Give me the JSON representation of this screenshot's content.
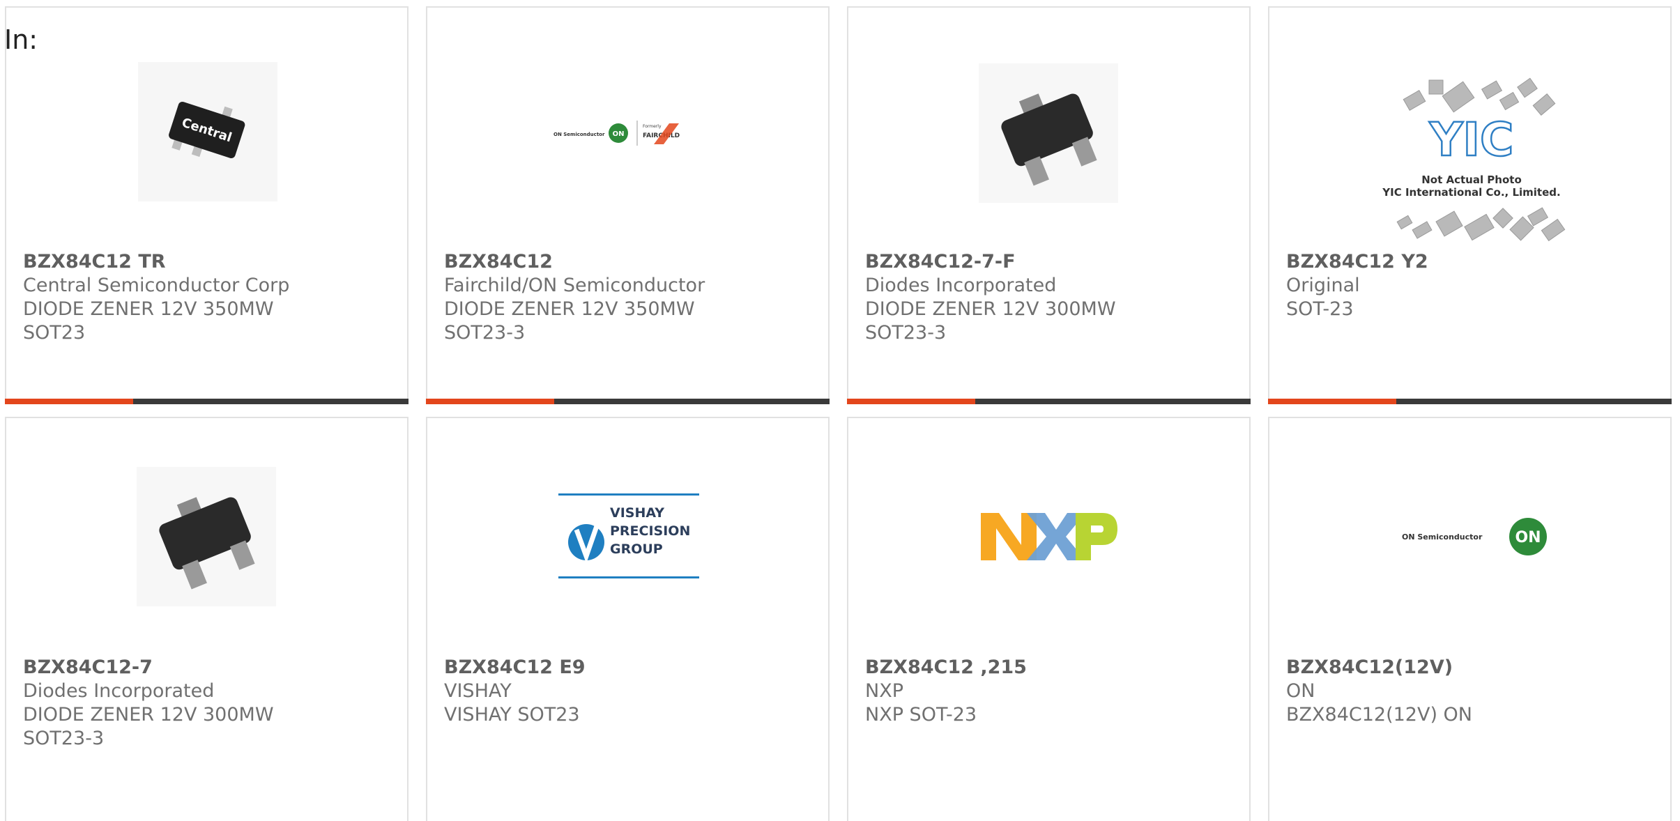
{
  "page": {
    "label": "In:"
  },
  "products": [
    {
      "part_number": "BZX84C12 TR",
      "manufacturer": "Central Semiconductor Corp",
      "description": "DIODE ZENER 12V 350MW",
      "package": "SOT23",
      "image": "central-sot23-icon",
      "brand_text": "Central"
    },
    {
      "part_number": "BZX84C12",
      "manufacturer": "Fairchild/ON Semiconductor",
      "description": "DIODE ZENER 12V 350MW",
      "package": "SOT23-3",
      "image": "on-fairchild-logo",
      "logo_on": "ON Semiconductor",
      "logo_formerly": "Formerly",
      "logo_fairchild": "FAIRCHILD"
    },
    {
      "part_number": "BZX84C12-7-F",
      "manufacturer": "Diodes Incorporated",
      "description": "DIODE ZENER 12V 300MW",
      "package": "SOT23-3",
      "image": "sot23-package-icon"
    },
    {
      "part_number": "BZX84C12 Y2",
      "manufacturer": "Original",
      "description": "SOT-23",
      "package": "",
      "image": "yic-not-actual-photo",
      "yic_logo": "YIC",
      "yic_caption_1": "Not Actual Photo",
      "yic_caption_2": "YIC International Co., Limited."
    },
    {
      "part_number": "BZX84C12-7",
      "manufacturer": "Diodes Incorporated",
      "description": "DIODE ZENER 12V 300MW",
      "package": "SOT23-3",
      "image": "sot23-package-icon"
    },
    {
      "part_number": "BZX84C12 E9",
      "manufacturer": "VISHAY",
      "description": "VISHAY SOT23",
      "package": "",
      "image": "vishay-precision-logo",
      "logo_lines": [
        "VISHAY",
        "PRECISION",
        "GROUP"
      ]
    },
    {
      "part_number": "BZX84C12 ,215",
      "manufacturer": "NXP",
      "description": "NXP SOT-23",
      "package": "",
      "image": "nxp-logo",
      "logo_text": "NXP"
    },
    {
      "part_number": "BZX84C12(12V)",
      "manufacturer": "ON",
      "description": "BZX84C12(12V) ON",
      "package": "",
      "image": "on-semiconductor-logo",
      "logo_text": "ON Semiconductor",
      "logo_badge": "ON"
    }
  ],
  "colors": {
    "accent": "#e3461c",
    "bar": "#3a3a3a",
    "border": "#e1e1e1",
    "nxp_orange": "#f7a823",
    "nxp_blue": "#6ea0d4",
    "nxp_green": "#b8d433",
    "on_green": "#2e8b3a",
    "vishay_blue": "#1f7fc1"
  }
}
